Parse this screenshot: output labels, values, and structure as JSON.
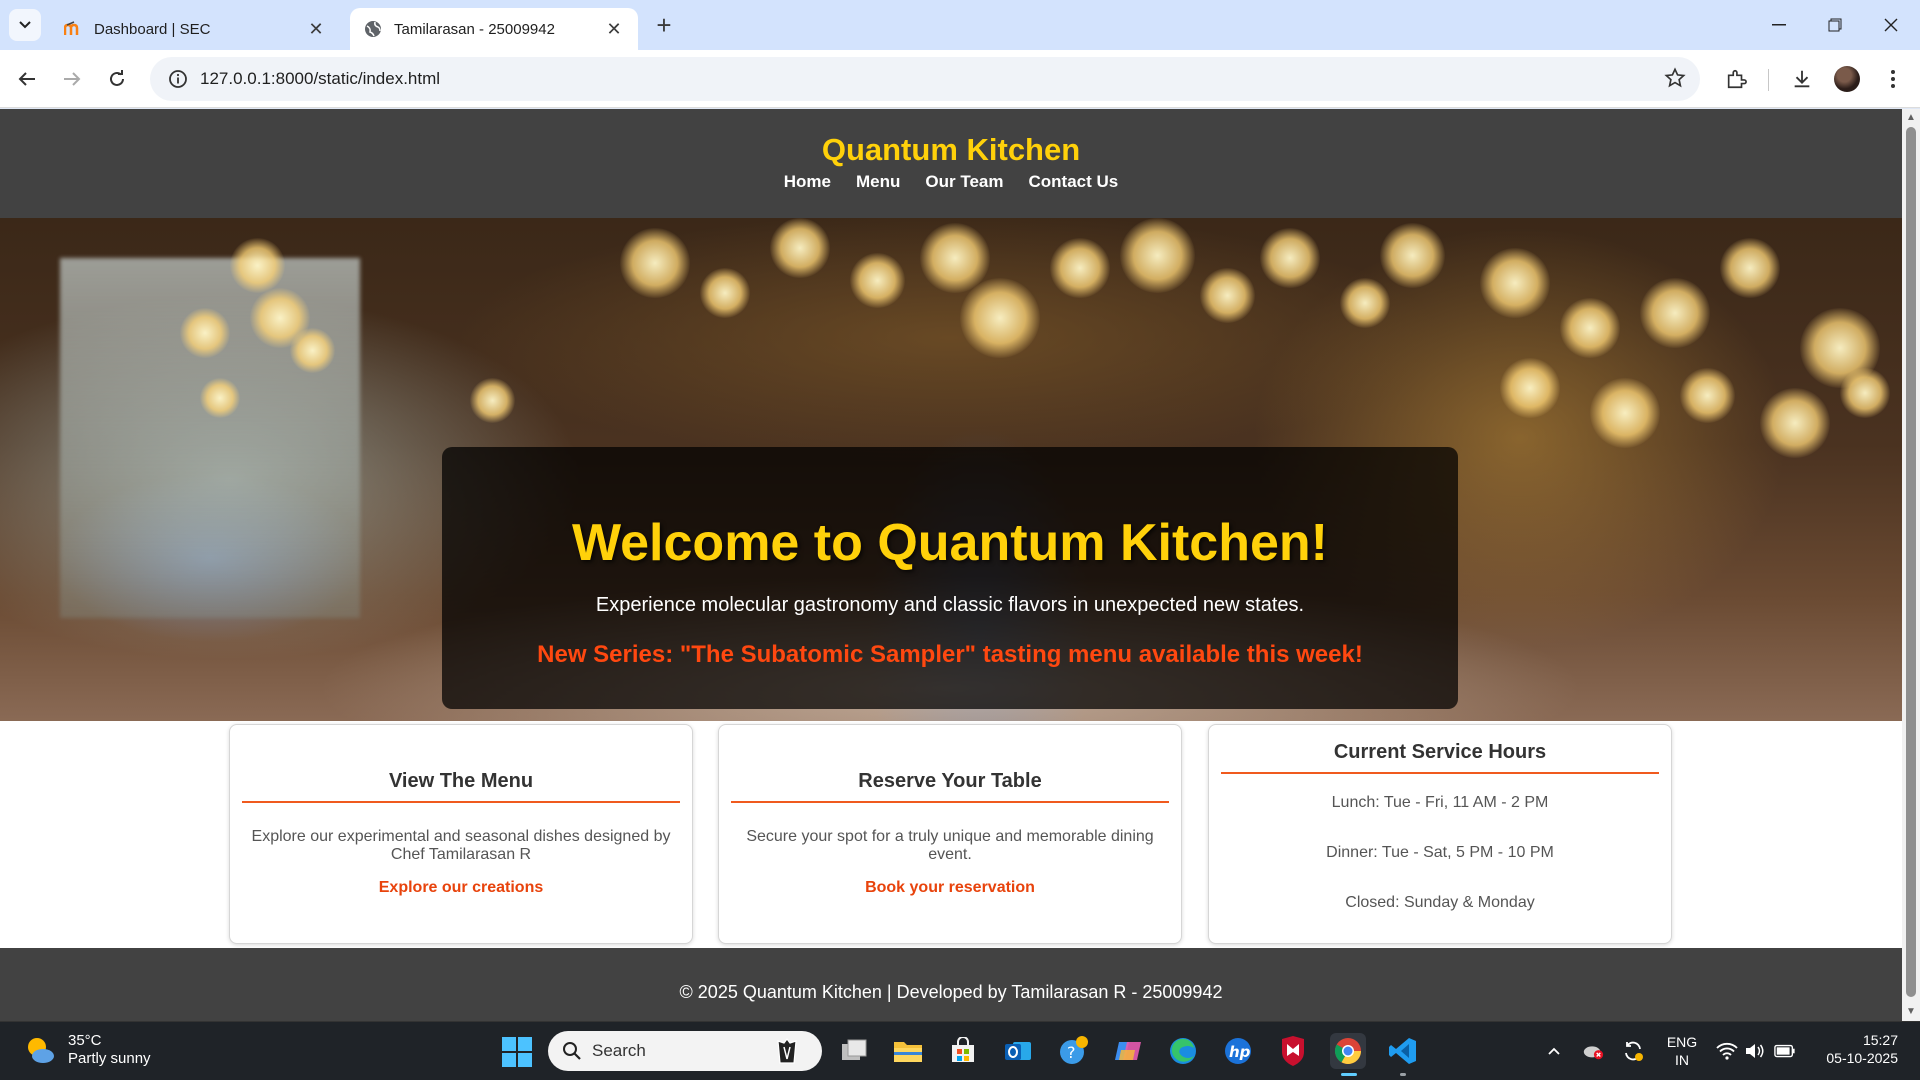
{
  "browser": {
    "tabs": [
      {
        "title": "Dashboard | SEC",
        "active": false
      },
      {
        "title": "Tamilarasan - 25009942",
        "active": true
      }
    ],
    "url": "127.0.0.1:8000/static/index.html"
  },
  "site": {
    "title": "Quantum Kitchen",
    "nav": [
      "Home",
      "Menu",
      "Our Team",
      "Contact Us"
    ],
    "hero": {
      "title": "Welcome to Quantum Kitchen!",
      "subtitle": "Experience molecular gastronomy and classic flavors in unexpected new states.",
      "announcement": "New Series: \"The Subatomic Sampler\" tasting menu available this week!"
    },
    "cards": [
      {
        "title": "View The Menu",
        "description": "Explore our experimental and seasonal dishes designed by Chef Tamilarasan R",
        "link": "Explore our creations"
      },
      {
        "title": "Reserve Your Table",
        "description": "Secure your spot for a truly unique and memorable dining event.",
        "link": "Book your reservation"
      }
    ],
    "hours": {
      "title": "Current Service Hours",
      "lines": [
        "Lunch: Tue - Fri, 11 AM - 2 PM",
        "Dinner: Tue - Sat, 5 PM - 10 PM",
        "Closed: Sunday & Monday"
      ]
    },
    "footer": "© 2025 Quantum Kitchen | Developed by Tamilarasan R - 25009942"
  },
  "taskbar": {
    "weather": {
      "temp": "35°C",
      "condition": "Partly sunny"
    },
    "search_placeholder": "Search",
    "language": [
      "ENG",
      "IN"
    ],
    "time": "15:27",
    "date": "05-10-2025",
    "apps": [
      "task-view",
      "file-explorer",
      "microsoft-store",
      "outlook",
      "get-help",
      "copilot",
      "edge",
      "hp",
      "mcafee",
      "chrome",
      "vscode"
    ]
  },
  "colors": {
    "accent_yellow": "#ffd10a",
    "accent_orange": "#e8430c",
    "header_bg": "#424242"
  }
}
